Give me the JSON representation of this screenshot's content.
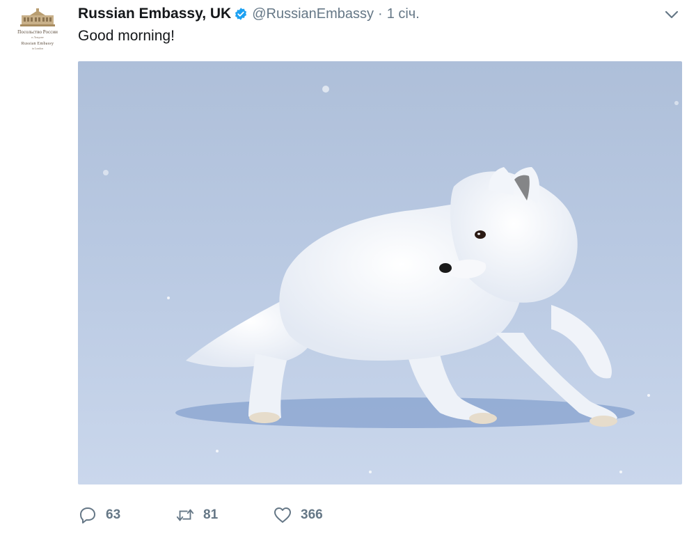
{
  "tweet": {
    "avatar": {
      "line1": "Посольство России",
      "line2": "в Лондоне",
      "line3": "Russian Embassy",
      "line4": "in London"
    },
    "author": {
      "display_name": "Russian Embassy, UK",
      "handle": "@RussianEmbassy",
      "verified": true
    },
    "separator": "·",
    "time": "1 січ.",
    "text": "Good morning!",
    "media": {
      "description": "arctic-fox-on-snow-photo",
      "colors": {
        "sky": "#b6c6de",
        "snow": "#c3d2ea",
        "fur": "#f4f6fa"
      }
    },
    "actions": {
      "reply_count": "63",
      "retweet_count": "81",
      "like_count": "366"
    },
    "colors": {
      "accent": "#1da1f2",
      "muted": "#657786",
      "text": "#14171a"
    }
  }
}
